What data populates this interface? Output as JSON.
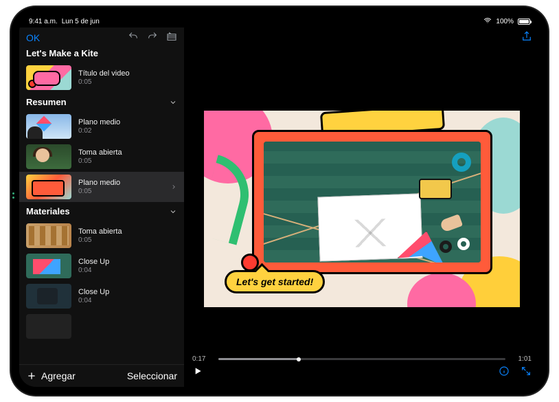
{
  "status": {
    "time": "9:41 a.m.",
    "date": "Lun 5 de jun",
    "battery_pct": "100%"
  },
  "sidebar": {
    "ok": "OK",
    "project_title": "Let's Make a Kite",
    "add": "Agregar",
    "select": "Seleccionar",
    "title_clip": {
      "label": "Título del video",
      "dur": "0:05"
    },
    "sections": [
      {
        "name": "Resumen",
        "clips": [
          {
            "label": "Plano medio",
            "dur": "0:02"
          },
          {
            "label": "Toma abierta",
            "dur": "0:05"
          },
          {
            "label": "Plano medio",
            "dur": "0:05",
            "selected": true
          }
        ]
      },
      {
        "name": "Materiales",
        "clips": [
          {
            "label": "Toma abierta",
            "dur": "0:05"
          },
          {
            "label": "Close Up",
            "dur": "0:04"
          },
          {
            "label": "Close Up",
            "dur": "0:04"
          }
        ]
      }
    ]
  },
  "viewer": {
    "bubble_text": "Let's get started!",
    "elapsed": "0:17",
    "remaining": "1:01"
  },
  "colors": {
    "accent_blue": "#0a84ff",
    "frame_red": "#ff5b3a",
    "bubble_yellow": "#ffd23f"
  }
}
